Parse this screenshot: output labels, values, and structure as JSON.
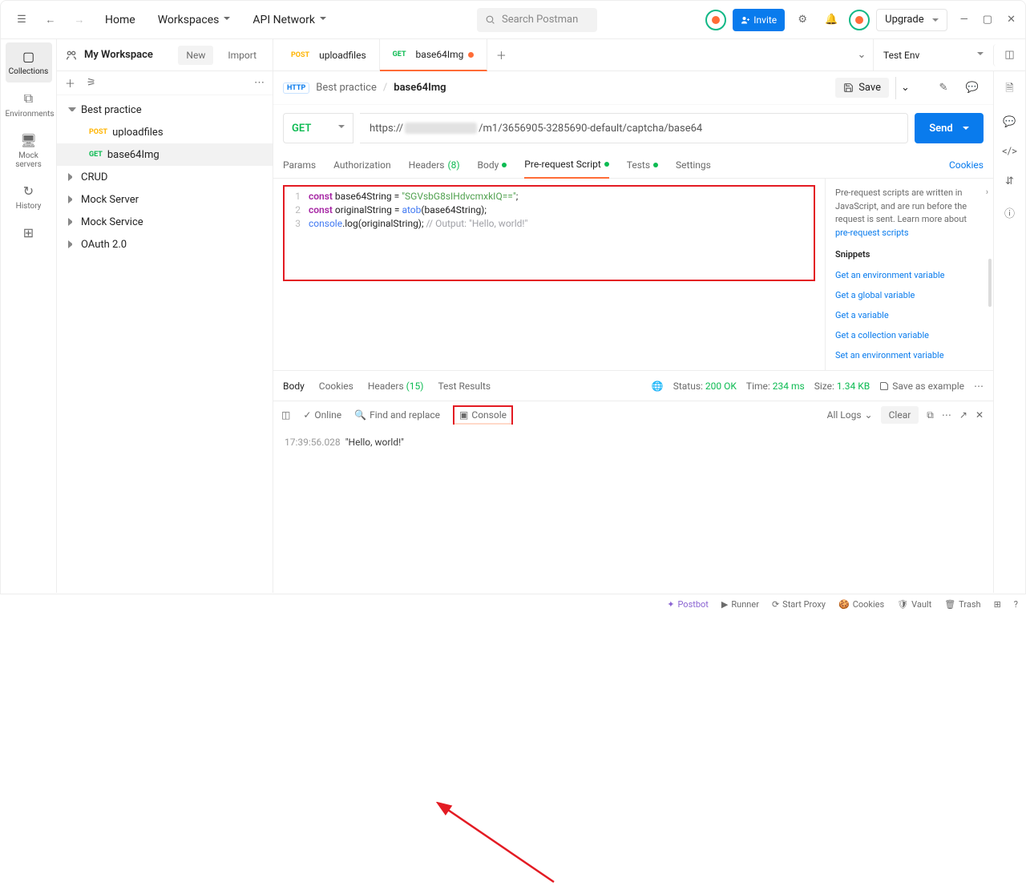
{
  "top": {
    "home": "Home",
    "workspaces": "Workspaces",
    "api_network": "API Network",
    "search_placeholder": "Search Postman",
    "invite": "Invite",
    "upgrade": "Upgrade"
  },
  "far_left": {
    "collections": "Collections",
    "environments": "Environments",
    "mock_servers": "Mock servers",
    "history": "History"
  },
  "sidebar": {
    "title": "My Workspace",
    "new": "New",
    "import": "Import",
    "tree": {
      "best_practice": "Best practice",
      "uploadfiles": "uploadfiles",
      "base64img": "base64Img",
      "crud": "CRUD",
      "mock_server": "Mock Server",
      "mock_service": "Mock Service",
      "oauth": "OAuth 2.0"
    }
  },
  "tabs": {
    "uploadfiles": "uploadfiles",
    "base64img": "base64Img",
    "env": "Test Env"
  },
  "breadcrumb": {
    "folder": "Best practice",
    "name": "base64Img",
    "save": "Save"
  },
  "request": {
    "method": "GET",
    "url_pre": "https://",
    "url_post": "/m1/3656905-3285690-default/captcha/base64",
    "send": "Send"
  },
  "req_tabs": {
    "params": "Params",
    "auth": "Authorization",
    "headers": "Headers",
    "headers_n": "(8)",
    "body": "Body",
    "prereq": "Pre-request Script",
    "tests": "Tests",
    "settings": "Settings",
    "cookies": "Cookies"
  },
  "code": {
    "l1a": "const",
    "l1b": " base64String = ",
    "l1c": "\"SGVsbG8sIHdvcmxkIQ==\"",
    "l1d": ";",
    "l2a": "const",
    "l2b": " originalString = ",
    "l2c": "atob",
    "l2d": "(base64String);",
    "l3a": "console",
    "l3b": ".log(originalString); ",
    "l3c": "// Output: \"Hello, world!\""
  },
  "snippets": {
    "help": "Pre-request scripts are written in JavaScript, and are run before the request is sent. Learn more about",
    "help_link": "pre-request scripts",
    "title": "Snippets",
    "items": [
      "Get an environment variable",
      "Get a global variable",
      "Get a variable",
      "Get a collection variable",
      "Set an environment variable"
    ]
  },
  "response": {
    "body": "Body",
    "cookies": "Cookies",
    "headers": "Headers",
    "headers_n": "(15)",
    "tests": "Test Results",
    "status_lbl": "Status:",
    "status_val": "200 OK",
    "time_lbl": "Time:",
    "time_val": "234 ms",
    "size_lbl": "Size:",
    "size_val": "1.34 KB",
    "save_example": "Save as example"
  },
  "footer": {
    "online": "Online",
    "find": "Find and replace",
    "console": "Console"
  },
  "logs": {
    "all": "All Logs",
    "clear": "Clear",
    "ts": "17:39:56.028",
    "msg": "\"Hello, world!\""
  },
  "status_bar": {
    "postbot": "Postbot",
    "runner": "Runner",
    "proxy": "Start Proxy",
    "cookies": "Cookies",
    "vault": "Vault",
    "trash": "Trash"
  }
}
